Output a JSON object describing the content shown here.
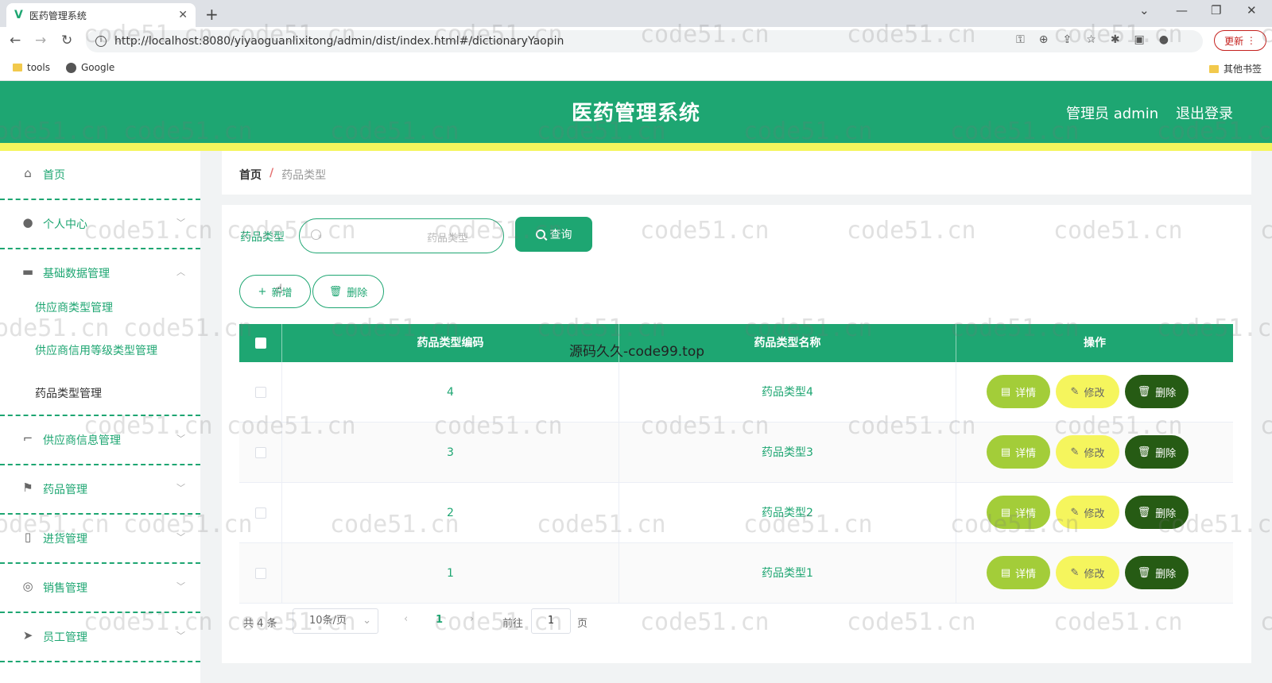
{
  "browser": {
    "tab_title": "医药管理系统",
    "tab_close": "✕",
    "new_tab": "+",
    "url": "http://localhost:8080/yiyaoguanlixitong/admin/dist/index.html#/dictionaryYaopin",
    "update_label": "更新",
    "bookmarks": [
      "tools",
      "Google"
    ],
    "other_bookmarks": "其他书签"
  },
  "header": {
    "title": "医药管理系统",
    "user": "管理员 admin",
    "logout": "退出登录"
  },
  "sidebar": {
    "items": [
      {
        "label": "首页",
        "icon": "home-icon"
      },
      {
        "label": "个人中心",
        "icon": "user-icon"
      },
      {
        "label": "基础数据管理",
        "icon": "monitor-icon"
      },
      {
        "label": "供应商信息管理",
        "icon": "crop-icon"
      },
      {
        "label": "药品管理",
        "icon": "flag-icon"
      },
      {
        "label": "进货管理",
        "icon": "bottle-icon"
      },
      {
        "label": "销售管理",
        "icon": "ring-icon"
      },
      {
        "label": "员工管理",
        "icon": "location-arrow-icon"
      }
    ],
    "submenu": [
      "供应商类型管理",
      "供应商信用等级类型管理",
      "药品类型管理"
    ]
  },
  "breadcrumb": {
    "home": "首页",
    "separator": "/",
    "current": "药品类型"
  },
  "search": {
    "label": "药品类型",
    "placeholder": "药品类型",
    "query_label": "查询"
  },
  "toolbar": {
    "add_label": "新增",
    "delete_label": "删除"
  },
  "table": {
    "headers": [
      "药品类型编码",
      "药品类型名称",
      "操作"
    ],
    "rows": [
      {
        "code": "4",
        "name": "药品类型4"
      },
      {
        "code": "3",
        "name": "药品类型3"
      },
      {
        "code": "2",
        "name": "药品类型2"
      },
      {
        "code": "1",
        "name": "药品类型1"
      }
    ],
    "actions": {
      "detail": "详情",
      "edit": "修改",
      "delete": "删除"
    }
  },
  "pagination": {
    "total": "共 4 条",
    "page_size": "10条/页",
    "current_page": "1",
    "goto_label": "前往",
    "goto_value": "1",
    "page_unit": "页"
  },
  "overlay_text": "源码久久-code99.top",
  "watermark": "code51.cn",
  "colors": {
    "primary": "#1ea672",
    "accent_yellow": "#f5f55d",
    "detail": "#a3cd39",
    "delete": "#265b14"
  }
}
